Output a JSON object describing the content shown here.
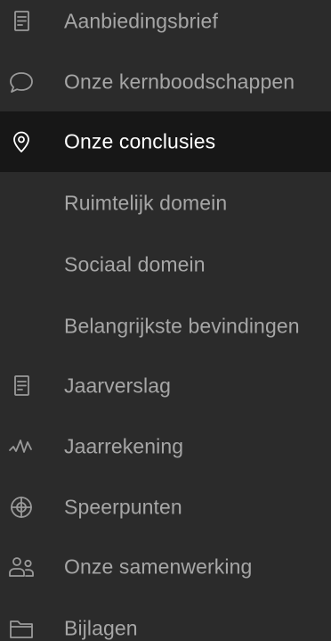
{
  "menu": {
    "items": [
      {
        "label": "Aanbiedingsbrief",
        "icon": "document-icon"
      },
      {
        "label": "Onze kernboodschappen",
        "icon": "speech-bubble-icon"
      },
      {
        "label": "Onze conclusies",
        "icon": "location-pin-icon",
        "active": true
      },
      {
        "label": "Ruimtelijk domein"
      },
      {
        "label": "Sociaal domein"
      },
      {
        "label": "Belangrijkste bevindingen"
      },
      {
        "label": "Jaarverslag",
        "icon": "document-icon"
      },
      {
        "label": "Jaarrekening",
        "icon": "pulse-icon"
      },
      {
        "label": "Speerpunten",
        "icon": "crosshair-icon"
      },
      {
        "label": "Onze samenwerking",
        "icon": "people-icon"
      },
      {
        "label": "Bijlagen",
        "icon": "folder-icon"
      }
    ]
  },
  "colors": {
    "background": "#2b2b2b",
    "active_background": "#171717",
    "text": "#a6a6a6",
    "active_text": "#ffffff",
    "icon": "#9a9a9a"
  }
}
